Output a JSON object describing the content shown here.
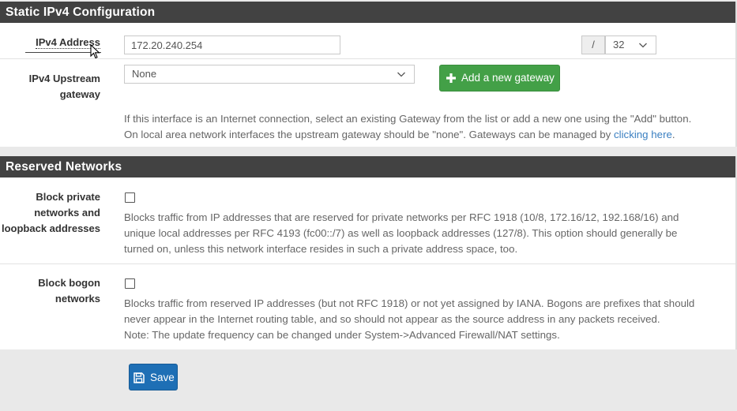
{
  "static_ipv4": {
    "heading": "Static IPv4 Configuration",
    "ipv4_address_label": "IPv4 Address",
    "ipv4_address_value": "172.20.240.254",
    "cidr_slash": "/",
    "cidr_value": "32",
    "upstream_label_line1": "IPv4 Upstream",
    "upstream_label_line2": "gateway",
    "upstream_value": "None",
    "add_gateway_label": "Add a new gateway",
    "help_line1": "If this interface is an Internet connection, select an existing Gateway from the list or add a new one using the \"Add\" button.",
    "help_line2_pre": "On local area network interfaces the upstream gateway should be \"none\". Gateways can be managed by ",
    "help_line2_link": "clicking here",
    "help_line2_post": "."
  },
  "reserved_networks": {
    "heading": "Reserved Networks",
    "block_private": {
      "label_line1": "Block private",
      "label_line2": "networks and",
      "label_line3": "loopback addresses",
      "checked": false,
      "help_line1": "Blocks traffic from IP addresses that are reserved for private networks per RFC 1918 (10/8, 172.16/12, 192.168/16) and",
      "help_line2": "unique local addresses per RFC 4193 (fc00::/7) as well as loopback addresses (127/8). This option should generally be",
      "help_line3": "turned on, unless this network interface resides in such a private address space, too."
    },
    "block_bogon": {
      "label_line1": "Block bogon",
      "label_line2": "networks",
      "checked": false,
      "help_line1": "Blocks traffic from reserved IP addresses (but not RFC 1918) or not yet assigned by IANA. Bogons are prefixes that should",
      "help_line2": "never appear in the Internet routing table, and so should not appear as the source address in any packets received.",
      "help_line3": "Note: The update frequency can be changed under System->Advanced Firewall/NAT settings."
    }
  },
  "save_label": "Save",
  "colors": {
    "heading_bg": "#424242",
    "add_button": "#43a047",
    "save_button": "#1e6fb5",
    "link": "#3a7fc1"
  }
}
